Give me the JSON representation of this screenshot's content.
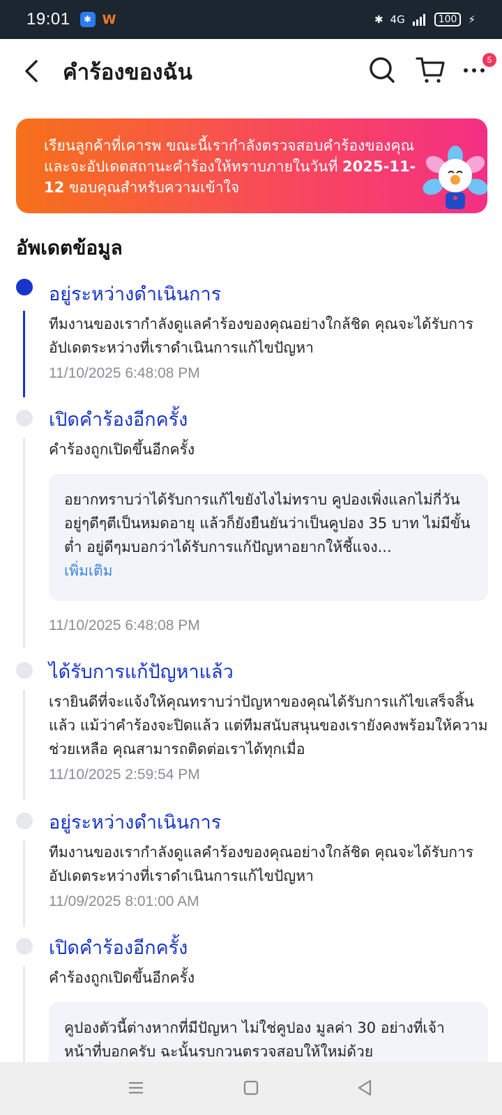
{
  "status_bar": {
    "time": "19:01",
    "network": "4G",
    "battery": "100",
    "icons": [
      "bluetooth-icon",
      "signal-icon",
      "battery-icon",
      "charging-icon"
    ]
  },
  "header": {
    "title": "คำร้องของฉัน",
    "cart_badge": "5",
    "icons": [
      "back-arrow-icon",
      "search-icon",
      "cart-icon",
      "more-icon"
    ]
  },
  "banner": {
    "text_before": "เรียนลูกค้าที่เคารพ ขณะนี้เรากำลังตรวจสอบคำร้องของคุณและจะอัปเดตสถานะคำร้องให้ทราบภายในวันที่ ",
    "date": "2025-11-12",
    "text_after": " ขอบคุณสำหรับความเข้าใจ",
    "colors": [
      "#f7711a",
      "#f42f84"
    ]
  },
  "section_title": "อัพเดตข้อมูล",
  "timeline": [
    {
      "title": "อยู่ระหว่างดำเนินการ",
      "desc": "ทีมงานของเรากำลังดูแลคำร้องของคุณอย่างใกล้ชิด คุณจะได้รับการอัปเดตระหว่างที่เราดำเนินการแก้ไขปัญหา",
      "time": "11/10/2025 6:48:08 PM"
    },
    {
      "title": "เปิดคำร้องอีกครั้ง",
      "desc": "คำร้องถูกเปิดขึ้นอีกครั้ง",
      "note": "อยากทราบว่าได้รับการแก้ไขยังไงไม่ทราบ คูปองเพิ่งแลกไม่กี่วัน อยู่ๆดีๆตีเป็นหมดอายุ แล้วก็ยังยืนยันว่าเป็นคูปอง 35 บาท ไม่มีขั้นต่ำ อยู่ดีๆมบอกว่าได้รับการแก้ปัญหาอยากให้ชี้แจง...",
      "note_more": "เพิ่มเติม",
      "time": "11/10/2025 6:48:08 PM"
    },
    {
      "title": "ได้รับการแก้ปัญหาแล้ว",
      "desc": "เรายินดีที่จะแจ้งให้คุณทราบว่าปัญหาของคุณได้รับการแก้ไขเสร็จสิ้นแล้ว แม้ว่าคำร้องจะปิดแล้ว แต่ทีมสนับสนุนของเรายังคงพร้อมให้ความช่วยเหลือ คุณสามารถติดต่อเราได้ทุกเมื่อ",
      "time": "11/10/2025 2:59:54 PM"
    },
    {
      "title": "อยู่ระหว่างดำเนินการ",
      "desc": "ทีมงานของเรากำลังดูแลคำร้องของคุณอย่างใกล้ชิด คุณจะได้รับการอัปเดตระหว่างที่เราดำเนินการแก้ไขปัญหา",
      "time": "11/09/2025 8:01:00 AM"
    },
    {
      "title": "เปิดคำร้องอีกครั้ง",
      "desc": "คำร้องถูกเปิดขึ้นอีกครั้ง",
      "note": "คูปองตัวนี้ต่างหากที่มีปัญหา ไม่ใช่คูปอง มูลค่า 30 อย่างที่เจ้าหน้าที่บอกครับ ฉะนั้นรบกวนตรวจสอบให้ใหม่ด้วย"
    }
  ],
  "nav_bar": {
    "icons": [
      "menu-icon",
      "home-icon",
      "back-triangle-icon"
    ]
  },
  "colors": {
    "accent": "#1735c9",
    "link": "#3d83e0",
    "muted": "#8a8d93",
    "badge": "#f5365c"
  }
}
